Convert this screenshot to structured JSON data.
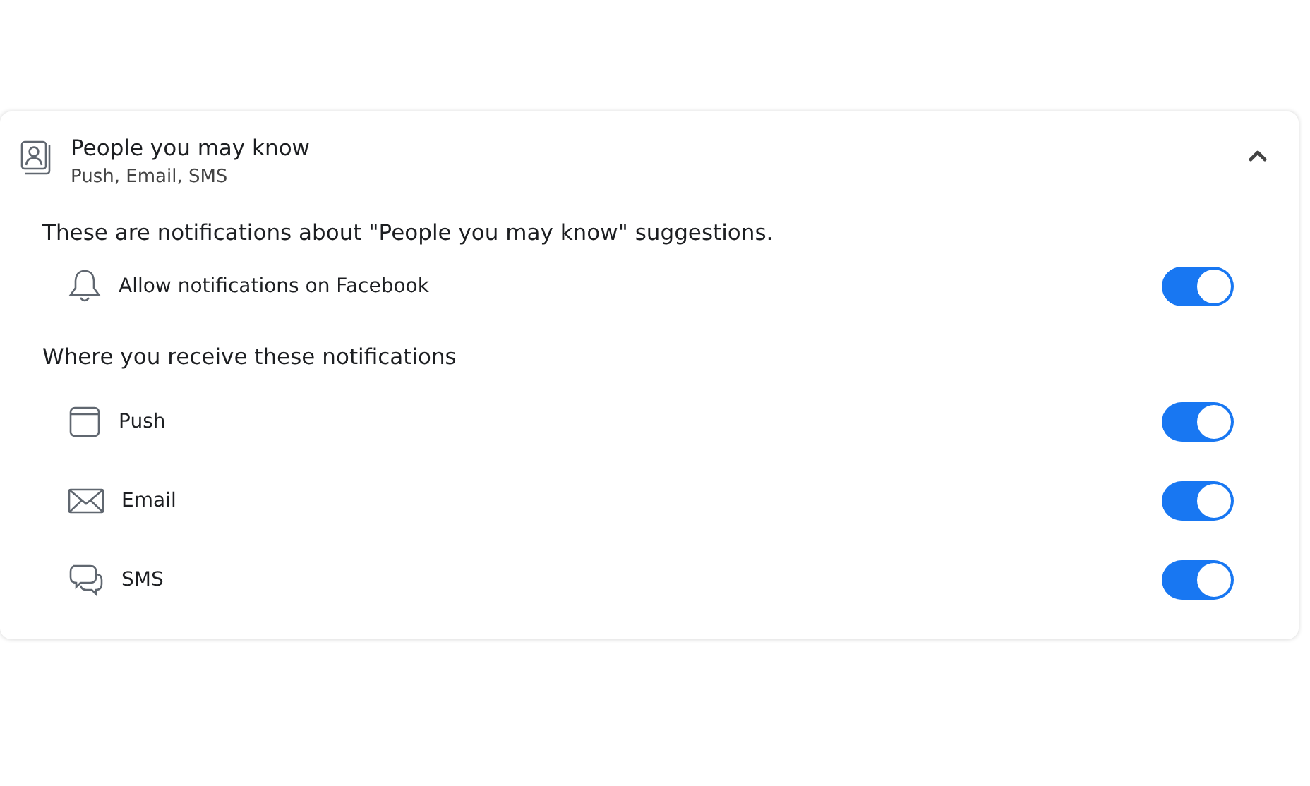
{
  "section": {
    "title": "People you may know",
    "subtitle": "Push, Email, SMS",
    "expanded": true
  },
  "description": "These are notifications about \"People you may know\" suggestions.",
  "allow": {
    "label": "Allow notifications on Facebook",
    "on": true
  },
  "channels_heading": "Where you receive these notifications",
  "channels": [
    {
      "label": "Push",
      "on": true
    },
    {
      "label": "Email",
      "on": true
    },
    {
      "label": "SMS",
      "on": true
    }
  ]
}
